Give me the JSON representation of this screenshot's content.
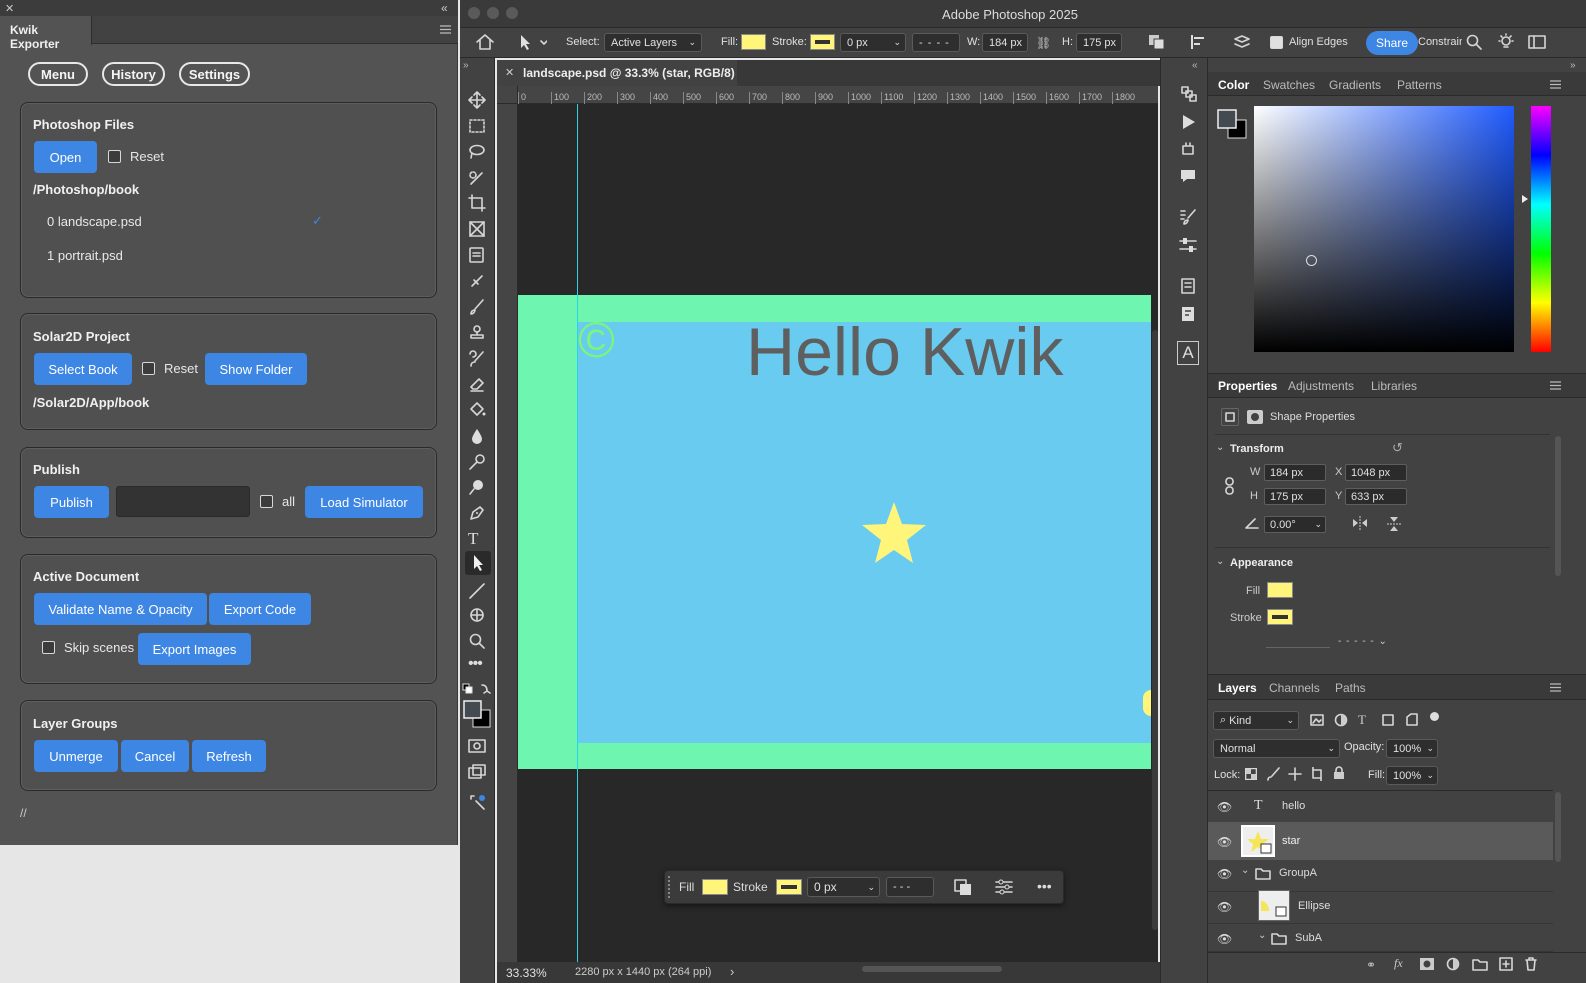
{
  "kwik": {
    "title": "Kwik Exporter",
    "top_nav": {
      "menu": "Menu",
      "history": "History",
      "settings": "Settings"
    },
    "photoshop_files": {
      "title": "Photoshop Files",
      "open": "Open",
      "reset": "Reset",
      "path": "/Photoshop/book",
      "files": [
        "0 landscape.psd",
        "1 portrait.psd"
      ],
      "selected_check": "✓"
    },
    "solar2d": {
      "title": "Solar2D Project",
      "select_book": "Select Book",
      "reset": "Reset",
      "show_folder": "Show Folder",
      "path": "/Solar2D/App/book"
    },
    "publish": {
      "title": "Publish",
      "publish": "Publish",
      "input_value": "",
      "all": "all",
      "load_simulator": "Load Simulator"
    },
    "active_document": {
      "title": "Active Document",
      "validate": "Validate Name & Opacity",
      "export_code": "Export Code",
      "skip_scenes": "Skip scenes",
      "export_images": "Export Images"
    },
    "layer_groups": {
      "title": "Layer Groups",
      "unmerge": "Unmerge",
      "cancel": "Cancel",
      "refresh": "Refresh"
    },
    "footer": "//"
  },
  "ps": {
    "app_title": "Adobe Photoshop 2025",
    "options": {
      "select_label": "Select:",
      "select_value": "Active Layers",
      "fill_label": "Fill:",
      "stroke_label": "Stroke:",
      "stroke_width": "0 px",
      "w_label": "W:",
      "w_value": "184 px",
      "h_label": "H:",
      "h_value": "175 px",
      "align_edges": "Align Edges",
      "share": "Share",
      "constrain": "Constrain"
    },
    "doc_tab": "landscape.psd @ 33.3% (star, RGB/8)",
    "ruler_ticks": [
      "0",
      "100",
      "200",
      "300",
      "400",
      "500",
      "600",
      "700",
      "800",
      "900",
      "1000",
      "1100",
      "1200",
      "1300",
      "1400",
      "1500",
      "1600",
      "1700",
      "1800"
    ],
    "canvas": {
      "headline": "Hello Kwik",
      "copyright": "©",
      "colors": {
        "green": "#6ef5b0",
        "blue": "#69cbef",
        "star": "#fff57a",
        "text": "#5f5f5f"
      }
    },
    "context_bar": {
      "fill": "Fill",
      "stroke": "Stroke",
      "width": "0 px"
    },
    "status": {
      "zoom": "33.33%",
      "info": "2280 px x 1440 px (264 ppi)",
      "arrow": "›"
    },
    "color_panel": {
      "tabs": [
        "Color",
        "Swatches",
        "Gradients",
        "Patterns"
      ]
    },
    "properties": {
      "tabs": [
        "Properties",
        "Adjustments",
        "Libraries"
      ],
      "shape_properties": "Shape Properties",
      "transform": "Transform",
      "w_label": "W",
      "w_value": "184 px",
      "h_label": "H",
      "h_value": "175 px",
      "x_label": "X",
      "x_value": "1048 px",
      "y_label": "Y",
      "y_value": "633 px",
      "angle": "0.00°",
      "appearance": "Appearance",
      "fill": "Fill",
      "stroke": "Stroke"
    },
    "layers": {
      "tabs": [
        "Layers",
        "Channels",
        "Paths"
      ],
      "kind": "Kind",
      "blend": "Normal",
      "opacity_label": "Opacity:",
      "opacity_value": "100%",
      "lock_label": "Lock:",
      "fill_label": "Fill:",
      "fill_value": "100%",
      "items": [
        "hello",
        "star",
        "GroupA",
        "Ellipse",
        "SubA"
      ]
    }
  }
}
